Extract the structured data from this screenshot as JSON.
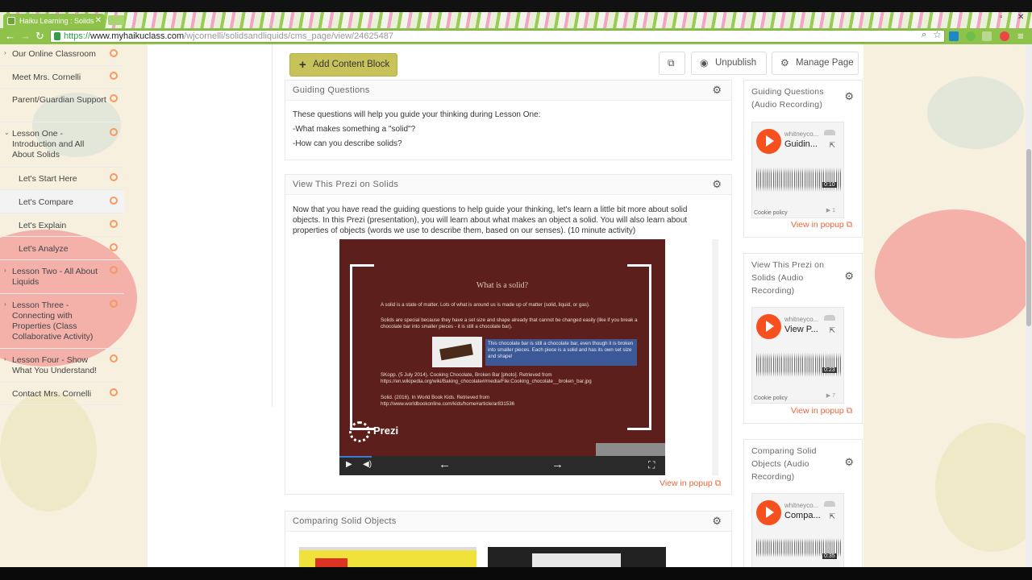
{
  "browser": {
    "tab_title": "Haiku Learning : Solids",
    "url_https": "https://",
    "url_host": "www.myhaikuclass.com",
    "url_path": "/wjcornelli/solidsandliquids/cms_page/view/24625487",
    "accent": "#8fc24a"
  },
  "sidebar": {
    "items": [
      {
        "label": "Our Online Classroom"
      },
      {
        "label": "Meet Mrs. Cornelli"
      },
      {
        "label": "Parent/Guardian Support"
      },
      {
        "label": "Lesson One - Introduction and All About Solids"
      },
      {
        "label": "Let's Start Here"
      },
      {
        "label": "Let's Compare"
      },
      {
        "label": "Let's Explain"
      },
      {
        "label": "Let's Analyze"
      },
      {
        "label": "Lesson Two - All About Liquids"
      },
      {
        "label": "Lesson Three - Connecting with Properties (Class Collaborative Activity)"
      },
      {
        "label": "Lesson Four - Show What You Understand!"
      },
      {
        "label": "Contact Mrs. Cornelli"
      }
    ]
  },
  "toolbar": {
    "add_content_block": "Add Content Block",
    "unpublish": "Unpublish",
    "manage_page": "Manage Page"
  },
  "blocks": {
    "guiding": {
      "title": "Guiding Questions",
      "lines": [
        "These questions will help you guide your thinking during Lesson One:",
        "-What makes something a \"solid\"?",
        "-How can you describe solids?"
      ]
    },
    "prezi": {
      "title": "View This Prezi on Solids",
      "lines": [
        "Now that you have read the guiding questions to help guide your thinking, let's learn a little bit more about solid",
        "objects. In this Prezi (presentation), you will learn about what makes an object a solid. You will also learn about",
        "properties of objects (words we use to describe them, based on our senses). (10 minute activity)"
      ],
      "slide": {
        "title": "What is a solid?",
        "p1": "A solid is a state of matter. Lots of what is around us is made up of matter (solid, liquid, or gas).",
        "p2": "Solids are special because they have a set size and shape already that cannot be changed easily (like if you break a chocolate bar into smaller pieces - it is still a chocolate bar).",
        "highlight": "This chocolate bar is still a chocolate bar, even though it is broken into smaller pieces. Each piece is a solid and has its own set size and shape!",
        "cite1": "SKopp. (5 July 2014). Cooking Chocolate, Broken Bar [photo]. Retrieved from https://en.wikipedia.org/wiki/Baking_chocolate#/media/File:Cooking_chocolate__broken_bar.jpg",
        "cite2": "Solid. (2016). In World Book Kids. Retrieved from http://www.worldbookonline.com/kids/home#article/ar831536",
        "logo": "Prezi"
      },
      "view_popup": "View in popup"
    },
    "comparing": {
      "title": "Comparing Solid Objects"
    }
  },
  "right_cards": [
    {
      "title": "Guiding Questions (Audio Recording)",
      "user": "whitneyco...",
      "track": "Guidin...",
      "time": "0:10",
      "plays": "1",
      "cookie": "Cookie policy",
      "popup": "View in popup"
    },
    {
      "title": "View This Prezi on Solids (Audio Recording)",
      "user": "whitneyco...",
      "track": "View P...",
      "time": "0:23",
      "plays": "7",
      "cookie": "Cookie policy",
      "popup": "View in popup"
    },
    {
      "title": "Comparing Solid Objects (Audio Recording)",
      "user": "whitneyco...",
      "track": "Compa...",
      "time": "0:35"
    }
  ]
}
